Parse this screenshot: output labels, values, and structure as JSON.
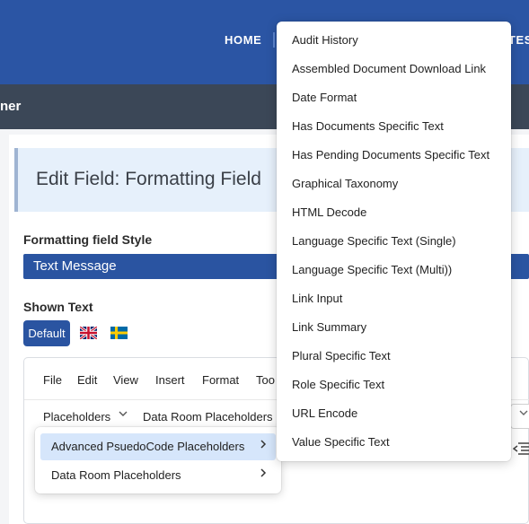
{
  "nav": {
    "home": "HOME",
    "partial": "TES"
  },
  "subbar": {
    "text": "ner"
  },
  "page": {
    "title": "Edit Field: Formatting Field"
  },
  "form": {
    "style_label": "Formatting field Style",
    "style_value": "Text Message",
    "shown_text_label": "Shown Text",
    "default_lang": "Default"
  },
  "editor": {
    "menubar": [
      "File",
      "Edit",
      "View",
      "Insert",
      "Format",
      "Too"
    ],
    "toolbar": {
      "placeholders": "Placeholders",
      "data_room": "Data Room Placeholders"
    }
  },
  "placeholders_menu": {
    "items": [
      "Advanced PsuedoCode Placeholders",
      "Data Room Placeholders"
    ]
  },
  "advanced_submenu": {
    "items": [
      "Audit History",
      "Assembled Document Download Link",
      "Date Format",
      "Has Documents Specific Text",
      "Has Pending Documents Specific Text",
      "Graphical Taxonomy",
      "HTML Decode",
      "Language Specific Text (Single)",
      "Language Specific Text (Multi))",
      "Link Input",
      "Link Summary",
      "Plural Specific Text",
      "Role Specific Text",
      "URL Encode",
      "Value Specific Text"
    ]
  },
  "colors": {
    "nav": "#2b55a4",
    "subbar": "#3b4757",
    "accent": "#2a54a1",
    "highlight": "#d6e6fb"
  }
}
